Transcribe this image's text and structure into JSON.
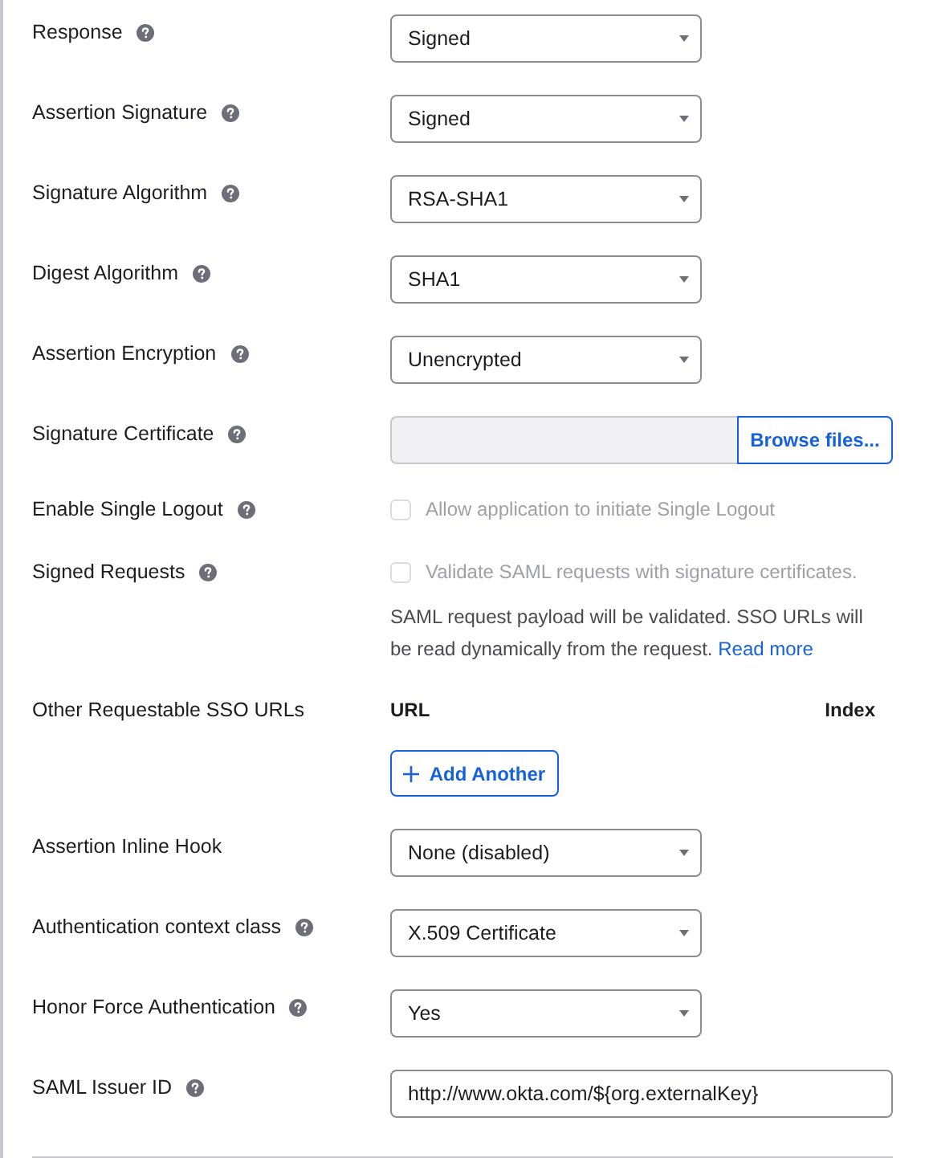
{
  "rows": [
    {
      "kind": "select",
      "label": "Response",
      "help": true,
      "value": "Signed"
    },
    {
      "kind": "select",
      "label": "Assertion Signature",
      "help": true,
      "value": "Signed"
    },
    {
      "kind": "select",
      "label": "Signature Algorithm",
      "help": true,
      "value": "RSA-SHA1"
    },
    {
      "kind": "select",
      "label": "Digest Algorithm",
      "help": true,
      "value": "SHA1"
    },
    {
      "kind": "select",
      "label": "Assertion Encryption",
      "help": true,
      "value": "Unencrypted"
    },
    {
      "kind": "file",
      "label": "Signature Certificate",
      "help": true,
      "button": "Browse files..."
    },
    {
      "kind": "checkbox",
      "label": "Enable Single Logout",
      "help": true,
      "checked": false,
      "disabled": true,
      "text": "Allow application to initiate Single Logout"
    },
    {
      "kind": "checkbox",
      "label": "Signed Requests",
      "help": true,
      "checked": false,
      "disabled": true,
      "text": "Validate SAML requests with signature certificates.",
      "description": "SAML request payload will be validated. SSO URLs will be read dynamically from the request.",
      "link": "Read more"
    },
    {
      "kind": "url_list",
      "label": "Other Requestable SSO URLs",
      "help": false,
      "columns": [
        "URL",
        "Index"
      ],
      "button": "Add Another"
    },
    {
      "kind": "select",
      "label": "Assertion Inline Hook",
      "help": false,
      "value": "None (disabled)"
    },
    {
      "kind": "select",
      "label": "Authentication context class",
      "help": true,
      "value": "X.509 Certificate"
    },
    {
      "kind": "select",
      "label": "Honor Force Authentication",
      "help": true,
      "value": "Yes"
    },
    {
      "kind": "text",
      "label": "SAML Issuer ID",
      "help": true,
      "value": "http://www.okta.com/${org.externalKey}"
    }
  ]
}
